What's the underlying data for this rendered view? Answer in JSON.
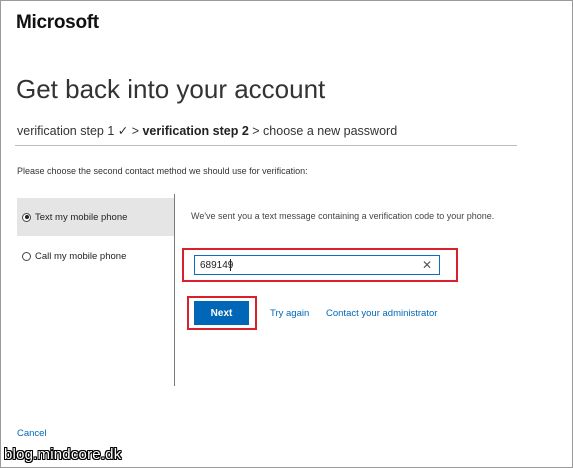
{
  "header": {
    "brand": "Microsoft"
  },
  "page": {
    "title": "Get back into your account"
  },
  "steps": {
    "step1": "verification step 1 ✓ >",
    "step2": "verification step 2",
    "step3": "> choose a new password"
  },
  "instruction": "Please choose the second contact method we should use for verification:",
  "options": [
    {
      "label": "Text my mobile phone",
      "selected": true
    },
    {
      "label": "Call my mobile phone",
      "selected": false
    }
  ],
  "verification": {
    "message": "We've sent you a text message containing a verification code to your phone.",
    "code_value": "689149",
    "clear_icon": "close-icon"
  },
  "actions": {
    "next_label": "Next",
    "try_again_label": "Try again",
    "contact_admin_label": "Contact your administrator",
    "cancel_label": "Cancel"
  },
  "watermark": "blog.mindcore.dk",
  "colors": {
    "accent": "#0067b8",
    "highlight_box": "#d9202b",
    "selected_bg": "#e5e5e5"
  }
}
